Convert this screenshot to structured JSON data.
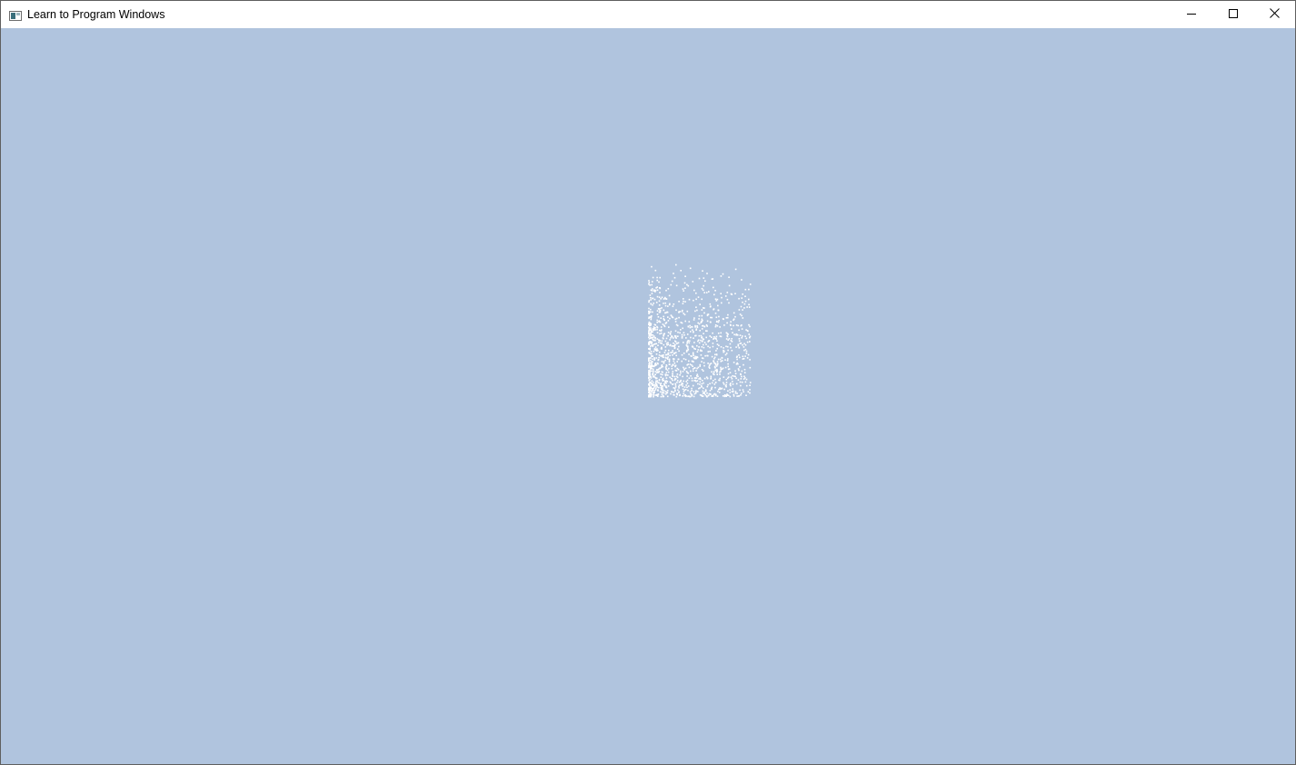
{
  "window": {
    "title": "Learn to Program Windows",
    "app_icon": "window-app-icon",
    "controls": {
      "minimize_icon": "minimize-icon",
      "maximize_icon": "maximize-icon",
      "close_icon": "close-icon"
    }
  },
  "client": {
    "background_color": "#b0c4de",
    "particle_color": "#ffffff"
  }
}
